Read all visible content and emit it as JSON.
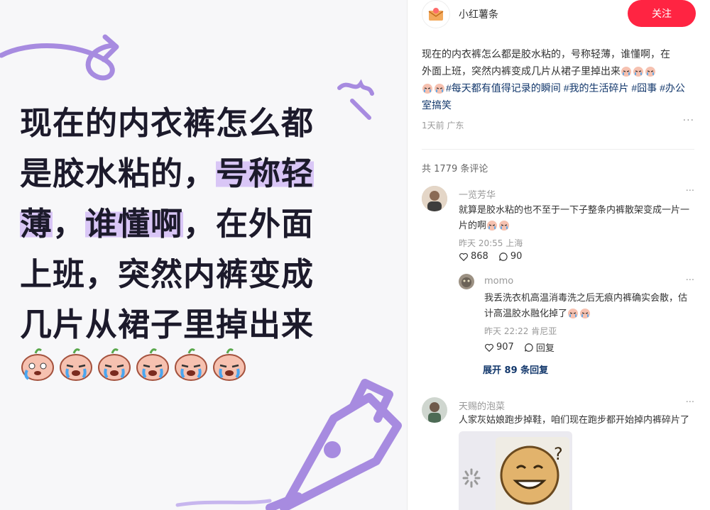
{
  "image": {
    "headline_lines": [
      {
        "plain": "现在的内衣裤怎么都",
        "hl": ""
      },
      {
        "plain": "是胶水粘的，",
        "hl": "号称轻"
      },
      {
        "hl_start": "薄",
        "mid": "，",
        "hl": "谁懂啊",
        "plain": "，在外面"
      },
      {
        "plain": "上班，突然内裤变成",
        "hl": ""
      },
      {
        "plain": "几片从裙子里掉出来",
        "hl": ""
      }
    ]
  },
  "post": {
    "author": "小红薯条",
    "follow_label": "关注",
    "text_line1": "现在的内衣裤怎么都是胶水粘的，号称轻薄，谁懂啊，在",
    "text_line2": "外面上班，突然内裤变成几片从裙子里掉出来",
    "tags": [
      "#每天都有值得记录的瞬间",
      "#我的生活碎片",
      "#囧事",
      "#办公室搞笑"
    ],
    "meta": "1天前 广东",
    "more": "···"
  },
  "comments_header": "共 1779 条评论",
  "comments": [
    {
      "name": "一览芳华",
      "text": "就算是胶水粘的也不至于一下子整条内裤散架变成一片一片的啊",
      "meta": "昨天 20:55 上海",
      "likes": "868",
      "replies": "90"
    },
    {
      "name": "momo",
      "text": "我丢洗衣机高温消毒洗之后无痕内裤确实会散，估计高温胶水融化掉了",
      "meta": "昨天 22:22 肯尼亚",
      "likes": "907",
      "reply_label": "回复"
    },
    {
      "name": "天赐的泡菜",
      "text": "人家灰姑娘跑步掉鞋，咱们现在跑步都开始掉内裤碎片了"
    }
  ],
  "expand_label": "展开 89 条回复",
  "colors": {
    "accent": "#ff2442",
    "tag": "#13386c",
    "highlight": "#d9c6f6",
    "deco_purple": "#a78be0"
  },
  "icons": [
    "envelope-logo-icon",
    "heart-icon",
    "comment-icon",
    "cry-face-icon",
    "pen-nib-icon",
    "loading-spinner-icon"
  ]
}
